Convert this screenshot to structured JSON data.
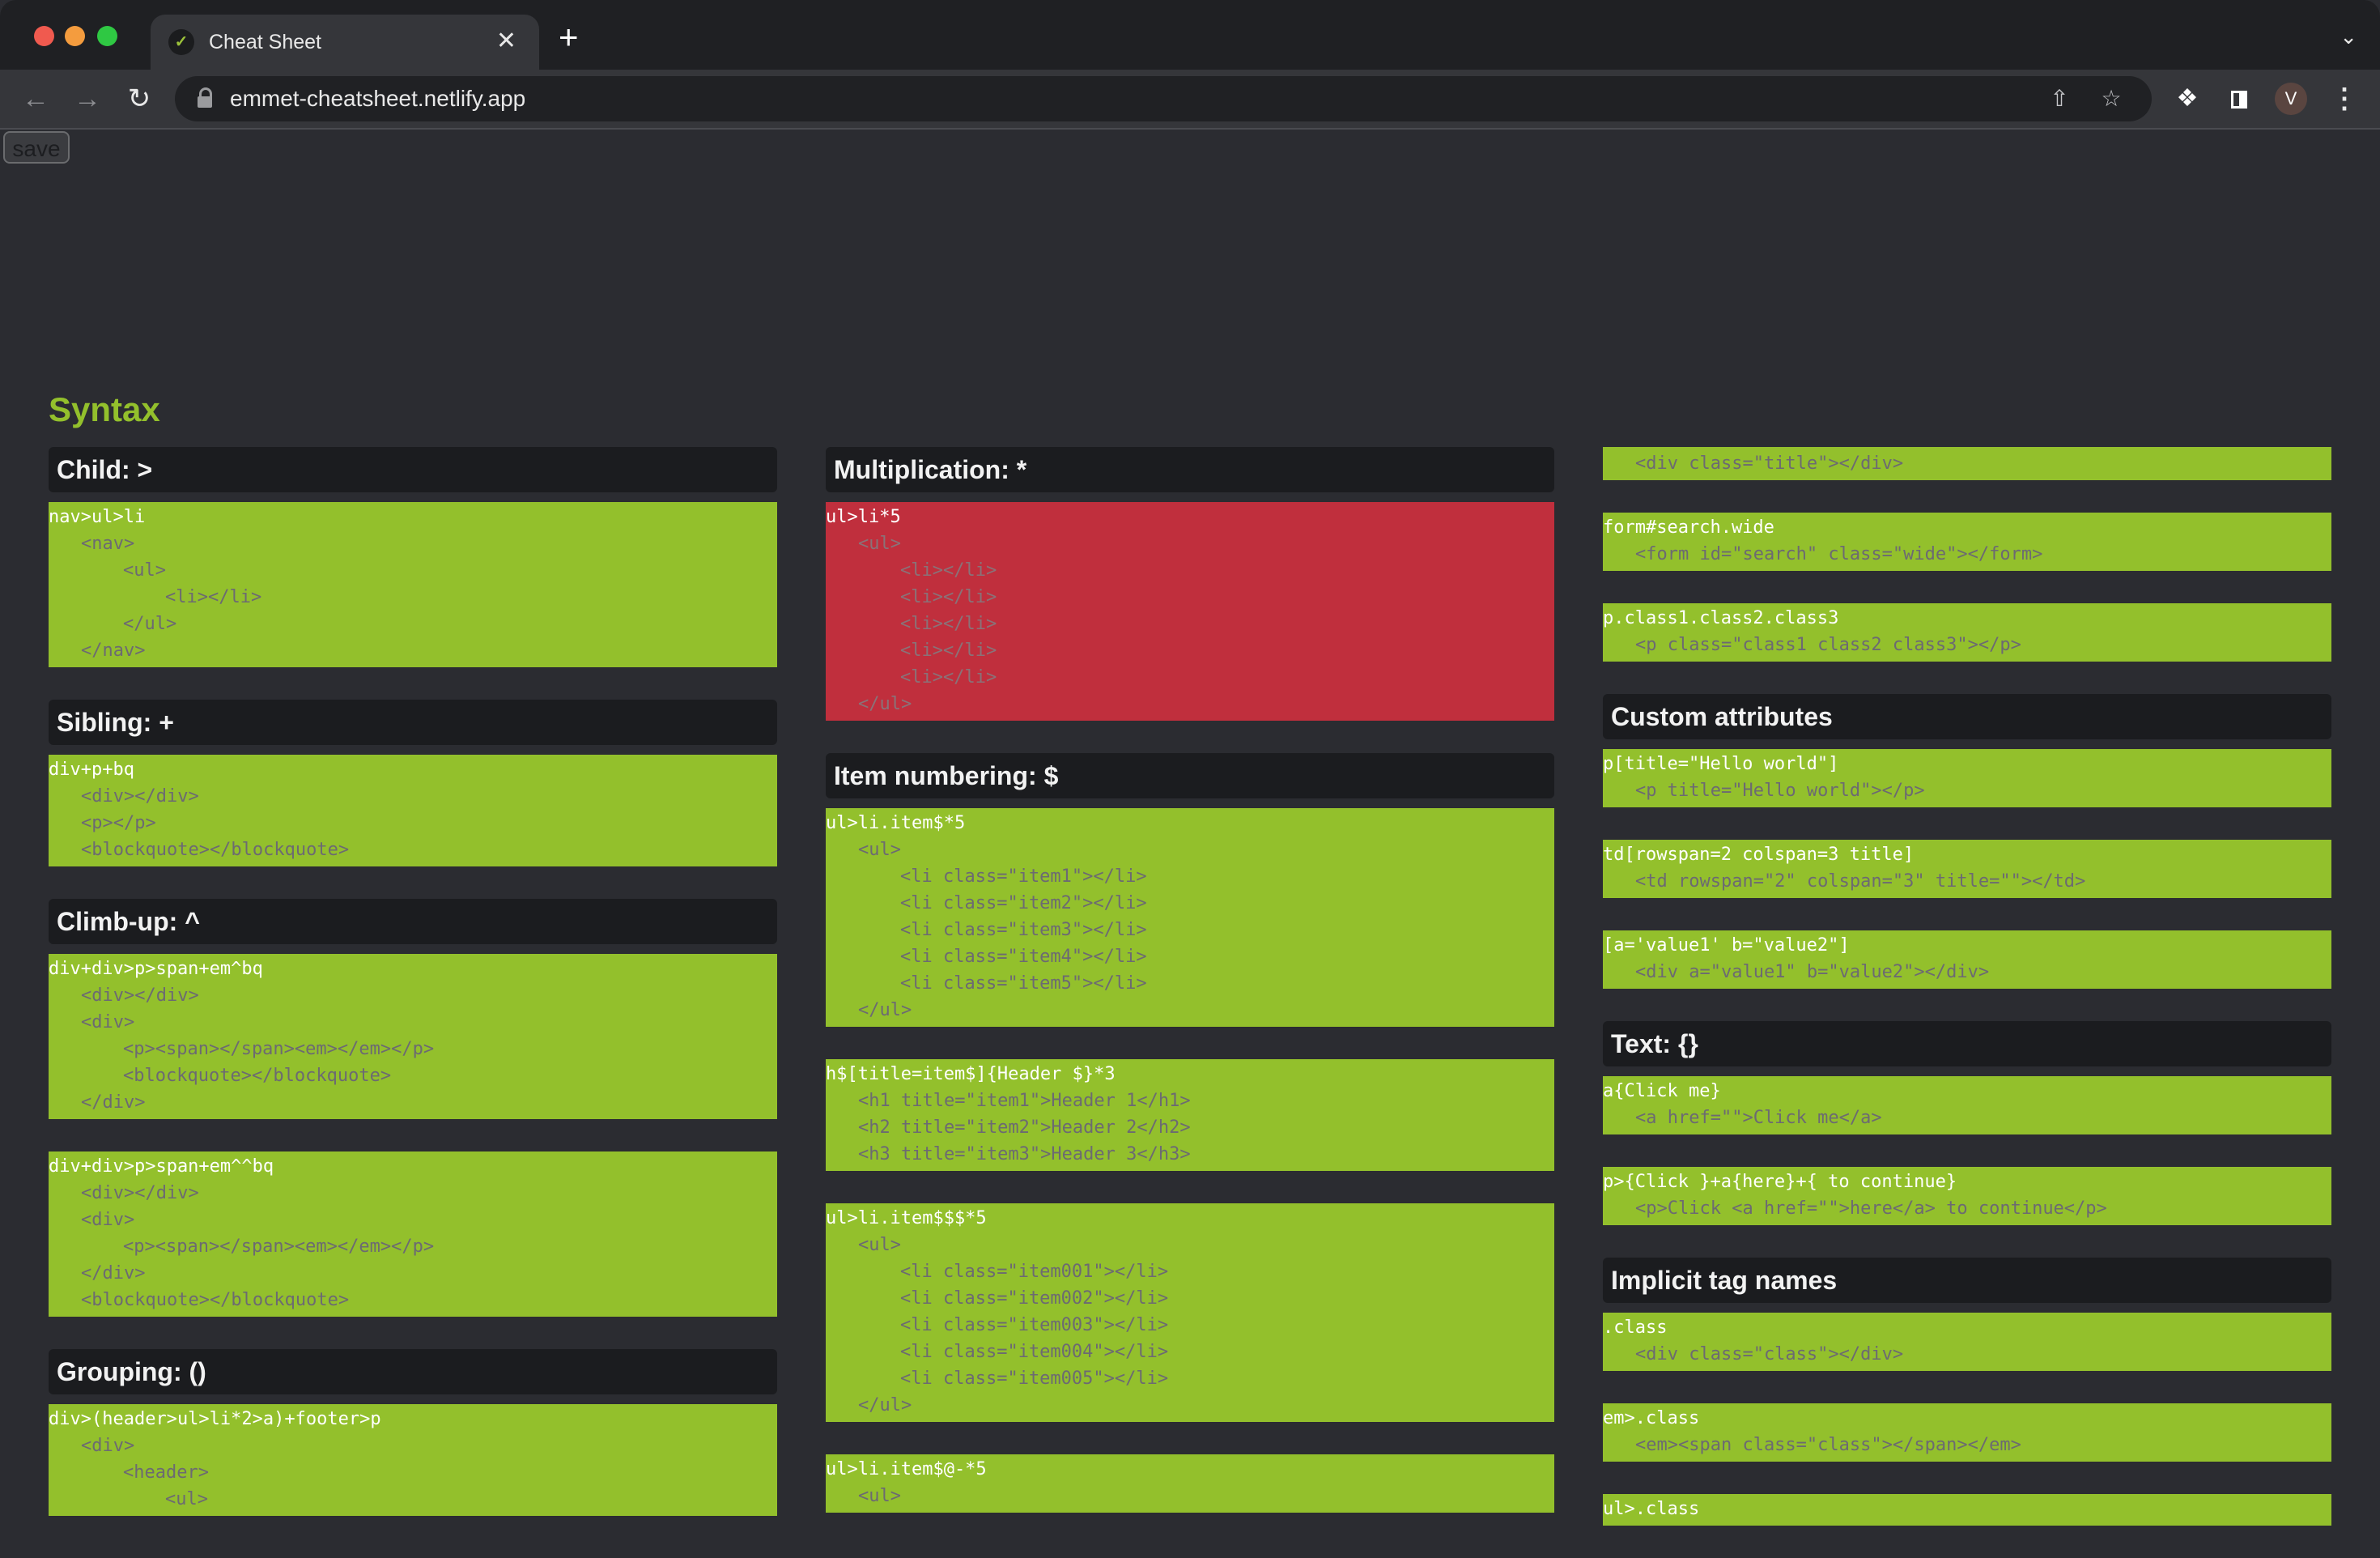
{
  "browser": {
    "tab_title": "Cheat Sheet",
    "url": "emmet-cheatsheet.netlify.app",
    "avatar_letter": "V",
    "icons": {
      "favicon": "emmet-logo-icon",
      "close": "close-icon",
      "new_tab": "plus-icon",
      "back": "arrow-left-icon",
      "forward": "arrow-right-icon",
      "reload": "reload-icon",
      "lock": "lock-icon",
      "share": "share-icon",
      "bookmark": "star-icon",
      "extensions": "puzzle-icon",
      "side_panel": "side-panel-icon",
      "menu": "kebab-menu-icon",
      "tab_list": "chevron-down-icon"
    }
  },
  "page": {
    "save_label": "save",
    "section_title": "Syntax",
    "colors": {
      "accent": "#93c02c",
      "highlight": "#c02f3d",
      "header_bg": "#1b1c1f",
      "page_bg": "#2b2c31"
    },
    "columns": [
      {
        "groups": [
          {
            "title": "Child: >",
            "examples": [
              {
                "abbr": "nav>ul>li",
                "output": [
                  "<nav>",
                  "    <ul>",
                  "        <li></li>",
                  "    </ul>",
                  "</nav>"
                ]
              }
            ]
          },
          {
            "title": "Sibling: +",
            "examples": [
              {
                "abbr": "div+p+bq",
                "output": [
                  "<div></div>",
                  "<p></p>",
                  "<blockquote></blockquote>"
                ]
              }
            ]
          },
          {
            "title": "Climb-up: ^",
            "examples": [
              {
                "abbr": "div+div>p>span+em^bq",
                "output": [
                  "<div></div>",
                  "<div>",
                  "    <p><span></span><em></em></p>",
                  "    <blockquote></blockquote>",
                  "</div>"
                ]
              },
              {
                "abbr": "div+div>p>span+em^^bq",
                "output": [
                  "<div></div>",
                  "<div>",
                  "    <p><span></span><em></em></p>",
                  "</div>",
                  "<blockquote></blockquote>"
                ]
              }
            ]
          },
          {
            "title": "Grouping: ()",
            "examples": [
              {
                "abbr": "div>(header>ul>li*2>a)+footer>p",
                "output": [
                  "<div>",
                  "    <header>",
                  "        <ul>"
                ]
              }
            ]
          }
        ]
      },
      {
        "groups": [
          {
            "title": "Multiplication: *",
            "examples": [
              {
                "abbr": "ul>li*5",
                "highlighted": true,
                "output": [
                  "<ul>",
                  "    <li></li>",
                  "    <li></li>",
                  "    <li></li>",
                  "    <li></li>",
                  "    <li></li>",
                  "</ul>"
                ]
              }
            ]
          },
          {
            "title": "Item numbering: $",
            "examples": [
              {
                "abbr": "ul>li.item$*5",
                "output": [
                  "<ul>",
                  "    <li class=\"item1\"></li>",
                  "    <li class=\"item2\"></li>",
                  "    <li class=\"item3\"></li>",
                  "    <li class=\"item4\"></li>",
                  "    <li class=\"item5\"></li>",
                  "</ul>"
                ]
              },
              {
                "abbr": "h$[title=item$]{Header $}*3",
                "output": [
                  "<h1 title=\"item1\">Header 1</h1>",
                  "<h2 title=\"item2\">Header 2</h2>",
                  "<h3 title=\"item3\">Header 3</h3>"
                ]
              },
              {
                "abbr": "ul>li.item$$$*5",
                "output": [
                  "<ul>",
                  "    <li class=\"item001\"></li>",
                  "    <li class=\"item002\"></li>",
                  "    <li class=\"item003\"></li>",
                  "    <li class=\"item004\"></li>",
                  "    <li class=\"item005\"></li>",
                  "</ul>"
                ]
              },
              {
                "abbr": "ul>li.item$@-*5",
                "output": [
                  "<ul>"
                ]
              }
            ]
          }
        ]
      },
      {
        "groups": [
          {
            "title": "",
            "examples": [
              {
                "abbr": "",
                "output": [
                  "<div class=\"title\"></div>"
                ]
              },
              {
                "abbr": "form#search.wide",
                "output": [
                  "<form id=\"search\" class=\"wide\"></form>"
                ]
              },
              {
                "abbr": "p.class1.class2.class3",
                "output": [
                  "<p class=\"class1 class2 class3\"></p>"
                ]
              }
            ]
          },
          {
            "title": "Custom attributes",
            "examples": [
              {
                "abbr": "p[title=\"Hello world\"]",
                "output": [
                  "<p title=\"Hello world\"></p>"
                ]
              },
              {
                "abbr": "td[rowspan=2 colspan=3 title]",
                "output": [
                  "<td rowspan=\"2\" colspan=\"3\" title=\"\"></td>"
                ]
              },
              {
                "abbr": "[a='value1' b=\"value2\"]",
                "output": [
                  "<div a=\"value1\" b=\"value2\"></div>"
                ]
              }
            ]
          },
          {
            "title": "Text: {}",
            "examples": [
              {
                "abbr": "a{Click me}",
                "output": [
                  "<a href=\"\">Click me</a>"
                ]
              },
              {
                "abbr": "p>{Click }+a{here}+{ to continue}",
                "output": [
                  "<p>Click <a href=\"\">here</a> to continue</p>"
                ]
              }
            ]
          },
          {
            "title": "Implicit tag names",
            "examples": [
              {
                "abbr": ".class",
                "output": [
                  "<div class=\"class\"></div>"
                ]
              },
              {
                "abbr": "em>.class",
                "output": [
                  "<em><span class=\"class\"></span></em>"
                ]
              },
              {
                "abbr": "ul>.class",
                "output": []
              }
            ]
          }
        ]
      }
    ]
  }
}
